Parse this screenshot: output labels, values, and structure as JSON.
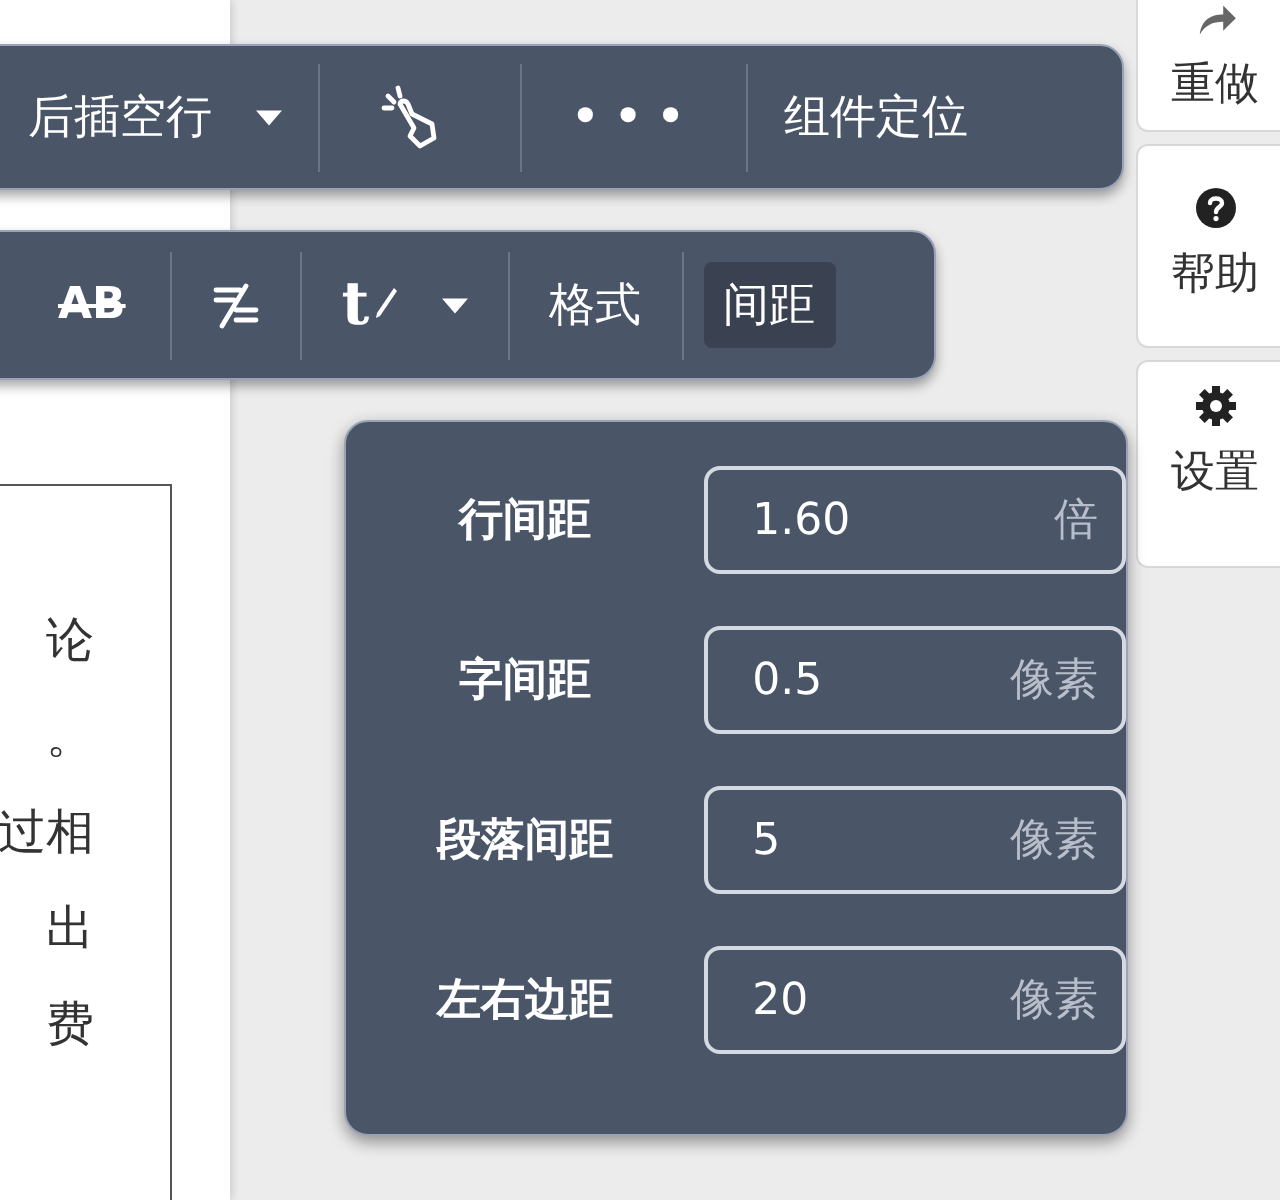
{
  "document": {
    "lines": [
      "论",
      "。",
      "过相",
      "出",
      "费"
    ]
  },
  "toolbar_top": {
    "items": [
      {
        "kind": "dropdown",
        "label": "后插空行"
      },
      {
        "kind": "tap"
      },
      {
        "kind": "more",
        "label": "•••"
      },
      {
        "kind": "button",
        "label": "组件定位"
      }
    ]
  },
  "toolbar_format": {
    "items": [
      {
        "kind": "strike",
        "label": "AB"
      },
      {
        "kind": "clear-format"
      },
      {
        "kind": "text-color",
        "label": "t"
      }
    ],
    "tabs": [
      {
        "label": "格式",
        "selected": false
      },
      {
        "label": "间距",
        "selected": true
      }
    ]
  },
  "sidebar": {
    "items": [
      {
        "kind": "redo",
        "label": "重做"
      },
      {
        "kind": "help",
        "label": "帮助"
      },
      {
        "kind": "settings",
        "label": "设置"
      }
    ]
  },
  "spacing_panel": {
    "rows": [
      {
        "label": "行间距",
        "value": "1.60",
        "unit": "倍"
      },
      {
        "label": "字间距",
        "value": "0.5",
        "unit": "像素"
      },
      {
        "label": "段落间距",
        "value": "5",
        "unit": "像素"
      },
      {
        "label": "左右边距",
        "value": "20",
        "unit": "像素"
      }
    ]
  }
}
